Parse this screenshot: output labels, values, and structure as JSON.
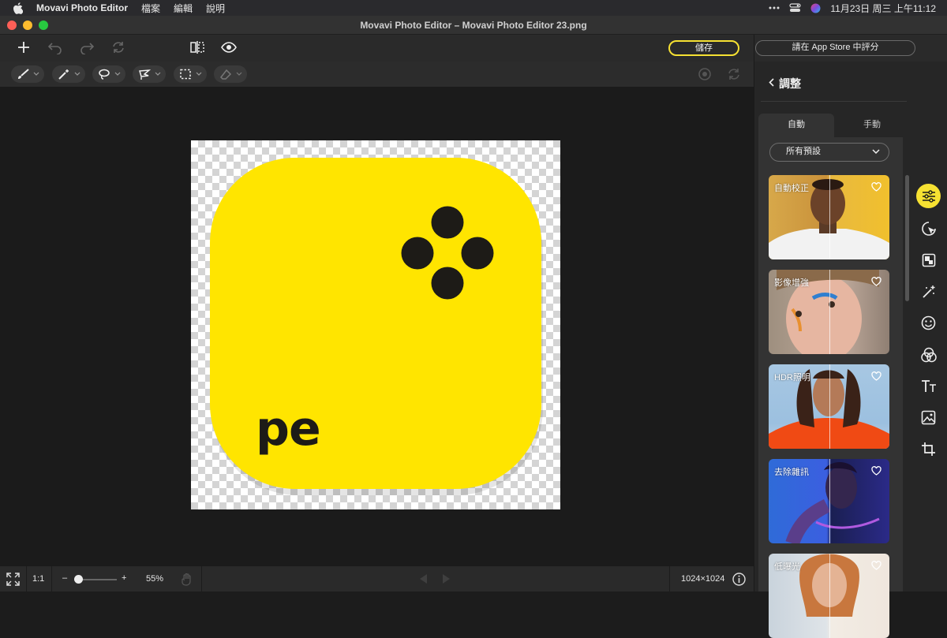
{
  "menubar": {
    "app": "Movavi Photo Editor",
    "items": [
      "檔案",
      "編輯",
      "說明"
    ],
    "clock": "11月23日 周三 上午11:12"
  },
  "window": {
    "title": "Movavi Photo Editor – Movavi Photo Editor 23.png"
  },
  "toolbar": {
    "save_label": "儲存",
    "rate_label": "請在 App Store 中評分"
  },
  "canvas": {
    "logo_text": "pe",
    "colors": {
      "brand_yellow": "#ffe500",
      "dark": "#1d1b17"
    }
  },
  "status": {
    "ratio_label": "1:1",
    "zoom_minus": "–",
    "zoom_plus": "+",
    "zoom_value": "55%",
    "zoom_level": 0.1,
    "dimensions": "1024×1024"
  },
  "panel": {
    "title": "調整",
    "tabs": [
      "自動",
      "手動"
    ],
    "active_tab": "自動",
    "preset_value": "所有預設",
    "cards": [
      {
        "label": "自動校正"
      },
      {
        "label": "影像增強"
      },
      {
        "label": "HDR照明"
      },
      {
        "label": "去除雜訊"
      },
      {
        "label": "低曝光"
      }
    ]
  },
  "rail": {
    "icons": [
      "adjust-sliders-icon",
      "object-select-icon",
      "background-icon",
      "retouch-wand-icon",
      "face-icon",
      "filters-icon",
      "text-icon",
      "image-icon",
      "crop-icon"
    ],
    "active": "adjust-sliders-icon"
  }
}
